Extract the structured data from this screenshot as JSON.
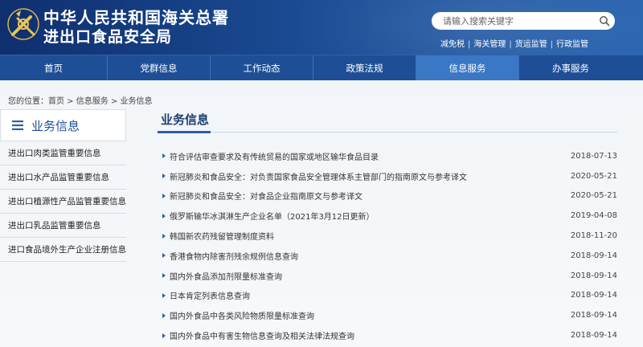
{
  "header": {
    "title_line1": "中华人民共和国海关总署",
    "title_line2": "进出口食品安全局",
    "search_placeholder": "请输入搜索关键字",
    "quick_links": [
      "减免税",
      "海关管理",
      "货运监管",
      "行政监管"
    ],
    "emblem_icon": "customs-emblem-icon"
  },
  "nav": [
    {
      "label": "首页",
      "active": false
    },
    {
      "label": "党群信息",
      "active": false
    },
    {
      "label": "工作动态",
      "active": false
    },
    {
      "label": "政策法规",
      "active": false
    },
    {
      "label": "信息服务",
      "active": true
    },
    {
      "label": "办事服务",
      "active": false
    }
  ],
  "breadcrumb": {
    "prefix": "您的位置：",
    "items": [
      "首页",
      "信息服务",
      "业务信息"
    ],
    "separator": " > "
  },
  "sidebar": {
    "title": "业务信息",
    "items": [
      "进出口肉类监管重要信息",
      "进出口水产品监管重要信息",
      "进出口植源性产品监管重要信息",
      "进出口乳品监管重要信息",
      "进口食品境外生产企业注册信息"
    ]
  },
  "main": {
    "title": "业务信息",
    "rows": [
      {
        "text": "符合评估审查要求及有传统贸易的国家或地区输华食品目录",
        "date": "2018-07-13"
      },
      {
        "text": "新冠肺炎和食品安全：对负责国家食品安全管理体系主管部门的指南原文与参考译文",
        "date": "2020-05-21"
      },
      {
        "text": "新冠肺炎和食品安全：对食品企业指南原文与参考译文",
        "date": "2020-05-21"
      },
      {
        "text": "俄罗斯输华冰淇淋生产企业名单（2021年3月12日更新）",
        "date": "2019-04-08"
      },
      {
        "text": "韩国新农药残留管理制度资料",
        "date": "2018-11-20"
      },
      {
        "text": "香港食物内除害剂残余规例信息查询",
        "date": "2018-09-14"
      },
      {
        "text": "国内外食品添加剂限量标准查询",
        "date": "2018-09-14"
      },
      {
        "text": "日本肯定列表信息查询",
        "date": "2018-09-14"
      },
      {
        "text": "国内外食品中各类风险物质限量标准查询",
        "date": "2018-09-14"
      },
      {
        "text": "国内外食品中有害生物信息查询及相关法律法规查询",
        "date": "2018-09-14"
      }
    ]
  },
  "colors": {
    "header_dark": "#0f2f6e",
    "nav_bg": "#1e4f96",
    "nav_active": "#3a77c4",
    "accent": "#2d5fa6"
  }
}
